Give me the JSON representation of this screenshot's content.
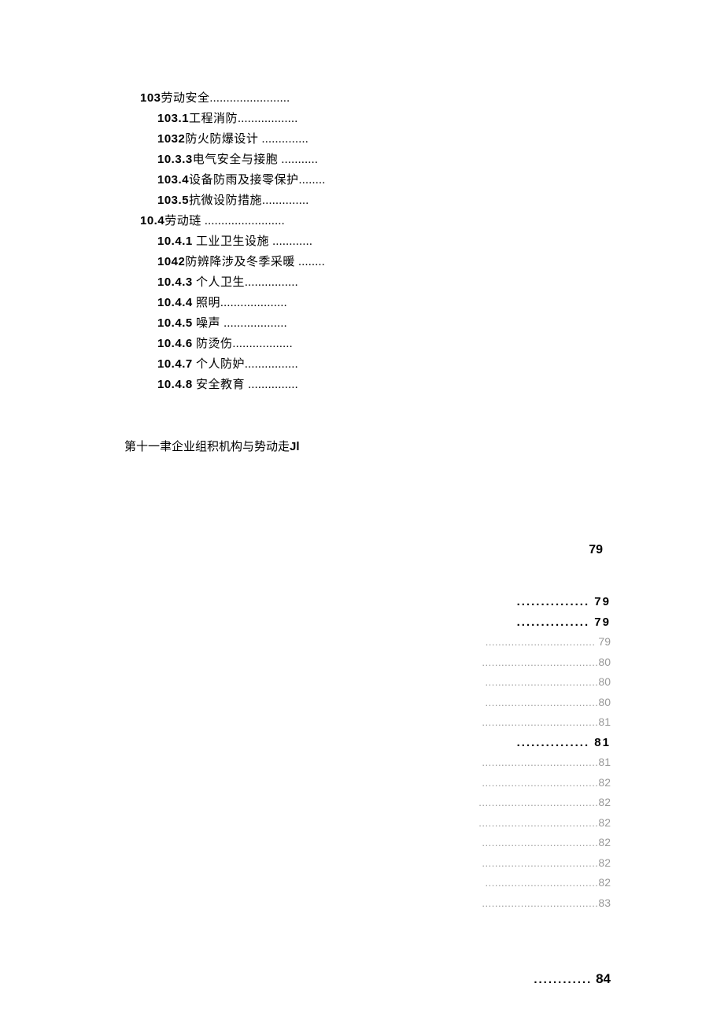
{
  "toc_upper": [
    {
      "lvl": 1,
      "num": "103",
      "txt": "劳动安全",
      "dots": "........................"
    },
    {
      "lvl": 2,
      "num": "103.1",
      "txt": "工程消防",
      "dots": ".................."
    },
    {
      "lvl": 2,
      "num": "1032",
      "txt": "防火防爆设计",
      "dots": " .............."
    },
    {
      "lvl": 2,
      "num": "10.3.3",
      "txt": "电气安全与接胞",
      "dots": " ..........."
    },
    {
      "lvl": 2,
      "num": "103.4",
      "txt": "设备防雨及接零保护",
      "dots": "........"
    },
    {
      "lvl": 2,
      "num": "103.5",
      "txt": "抗微设防措施",
      "dots": ".............."
    },
    {
      "lvl": 1,
      "num": "10.4",
      "txt": "劳动琏",
      "dots": " ........................"
    },
    {
      "lvl": 2,
      "num": "10.4.1",
      "txt": "  工业卫生设施",
      "dots": " ............"
    },
    {
      "lvl": 2,
      "num": "1042",
      "txt": "防辨降涉及冬季采暖",
      "dots": " ........"
    },
    {
      "lvl": 2,
      "num": "10.4.3",
      "txt": "  个人卫生",
      "dots": "................"
    },
    {
      "lvl": 2,
      "num": "10.4.4",
      "txt": "  照明",
      "dots": "...................."
    },
    {
      "lvl": 2,
      "num": "10.4.5",
      "txt": "  噪声",
      "dots": " ..................."
    },
    {
      "lvl": 2,
      "num": "10.4.6",
      "txt": "  防烫伤",
      "dots": ".................."
    },
    {
      "lvl": 2,
      "num": "10.4.7",
      "txt": "  个人防妒",
      "dots": "................"
    },
    {
      "lvl": 2,
      "num": "10.4.8",
      "txt": "  安全教育",
      "dots": " ..............."
    }
  ],
  "chapter_line": {
    "prefix": "第十一聿企业组积机构与势动走",
    "suffix": "Jl"
  },
  "page_top": "79",
  "toc_right": [
    {
      "style": "bold",
      "dots": "...............",
      "page": " 79"
    },
    {
      "style": "bold",
      "dots": "...............",
      "page": " 79"
    },
    {
      "style": "light",
      "dots": "..................................",
      "page": " 79"
    },
    {
      "style": "light",
      "dots": "....................................",
      "page": "80"
    },
    {
      "style": "light",
      "dots": "...................................",
      "page": "80"
    },
    {
      "style": "light",
      "dots": "...................................",
      "page": "80"
    },
    {
      "style": "light",
      "dots": "....................................",
      "page": "81"
    },
    {
      "style": "bold",
      "dots": "...............",
      "page": " 81"
    },
    {
      "style": "light",
      "dots": "....................................",
      "page": "81"
    },
    {
      "style": "light",
      "dots": "....................................",
      "page": "82"
    },
    {
      "style": "light",
      "dots": ".....................................",
      "page": "82"
    },
    {
      "style": "light",
      "dots": ".....................................",
      "page": "82"
    },
    {
      "style": "light",
      "dots": "....................................",
      "page": "82"
    },
    {
      "style": "light",
      "dots": "....................................",
      "page": "82"
    },
    {
      "style": "light",
      "dots": "...................................",
      "page": "82"
    },
    {
      "style": "light",
      "dots": "....................................",
      "page": "83"
    }
  ],
  "bottom_page": {
    "dots": "............",
    "page": " 84"
  }
}
